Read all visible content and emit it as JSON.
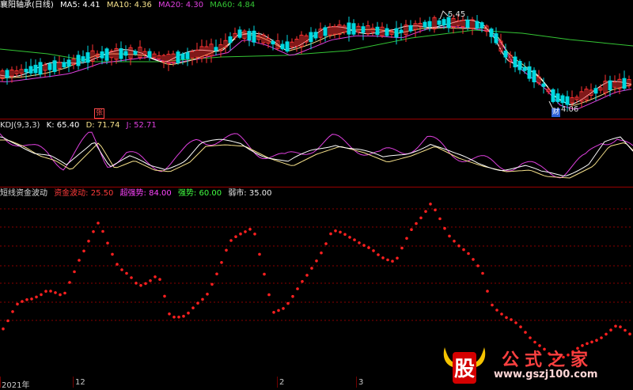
{
  "price_panel": {
    "stock_title": "襄阳轴承(日线)",
    "ma_labels": [
      {
        "label": "MA5: 4.41",
        "color": "#ffffff"
      },
      {
        "label": "MA10: 4.36",
        "color": "#f5e08a"
      },
      {
        "label": "MA20: 4.30",
        "color": "#e040e0"
      },
      {
        "label": "MA60: 4.84",
        "color": "#34c534"
      }
    ],
    "high_label": "5.45",
    "low_label": "4.06",
    "badge_zhang": "张",
    "badge_cai": "财"
  },
  "kdj_panel": {
    "name": "KDJ(9,3,3)",
    "k_label": "K: 65.40",
    "d_label": "D: 71.74",
    "j_label": "J: 52.71"
  },
  "fund_panel": {
    "name": "短线资金波动",
    "items": [
      {
        "label": "资金波动: 25.50",
        "color": "#ff3b3b"
      },
      {
        "label": "超强势: 84.00",
        "color": "#ff44ff"
      },
      {
        "label": "强势: 60.00",
        "color": "#41ff41"
      },
      {
        "label": "弱市: 35.00",
        "color": "#eeeeee"
      }
    ]
  },
  "x_axis": [
    "2021年",
    "12",
    "2",
    "3"
  ],
  "watermark": {
    "logo_char": "股",
    "title": "公式之家",
    "url": "www.gszj100.com"
  },
  "colors": {
    "up": "#ff3232",
    "down": "#00d8e0",
    "ma5": "#ffffff",
    "ma10": "#f5e08a",
    "ma20": "#e040e0",
    "ma60": "#34c534",
    "k": "#ffffff",
    "d": "#f5e08a",
    "j": "#e040e0",
    "dots": "#ff2020",
    "grid": "#8a0000"
  }
}
